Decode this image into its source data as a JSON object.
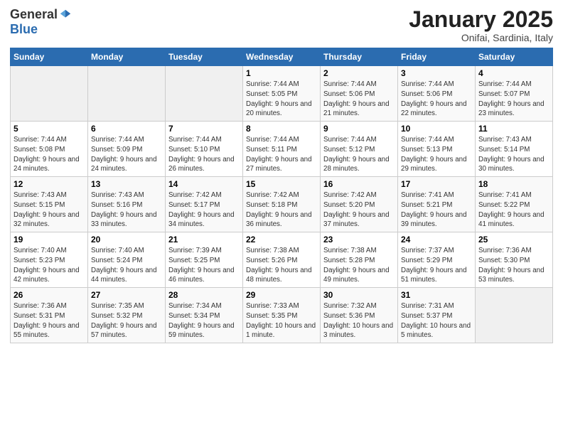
{
  "logo": {
    "general": "General",
    "blue": "Blue"
  },
  "header": {
    "month": "January 2025",
    "location": "Onifai, Sardinia, Italy"
  },
  "weekdays": [
    "Sunday",
    "Monday",
    "Tuesday",
    "Wednesday",
    "Thursday",
    "Friday",
    "Saturday"
  ],
  "weeks": [
    [
      {
        "day": "",
        "sunrise": "",
        "sunset": "",
        "daylight": ""
      },
      {
        "day": "",
        "sunrise": "",
        "sunset": "",
        "daylight": ""
      },
      {
        "day": "",
        "sunrise": "",
        "sunset": "",
        "daylight": ""
      },
      {
        "day": "1",
        "sunrise": "Sunrise: 7:44 AM",
        "sunset": "Sunset: 5:05 PM",
        "daylight": "Daylight: 9 hours and 20 minutes."
      },
      {
        "day": "2",
        "sunrise": "Sunrise: 7:44 AM",
        "sunset": "Sunset: 5:06 PM",
        "daylight": "Daylight: 9 hours and 21 minutes."
      },
      {
        "day": "3",
        "sunrise": "Sunrise: 7:44 AM",
        "sunset": "Sunset: 5:06 PM",
        "daylight": "Daylight: 9 hours and 22 minutes."
      },
      {
        "day": "4",
        "sunrise": "Sunrise: 7:44 AM",
        "sunset": "Sunset: 5:07 PM",
        "daylight": "Daylight: 9 hours and 23 minutes."
      }
    ],
    [
      {
        "day": "5",
        "sunrise": "Sunrise: 7:44 AM",
        "sunset": "Sunset: 5:08 PM",
        "daylight": "Daylight: 9 hours and 24 minutes."
      },
      {
        "day": "6",
        "sunrise": "Sunrise: 7:44 AM",
        "sunset": "Sunset: 5:09 PM",
        "daylight": "Daylight: 9 hours and 24 minutes."
      },
      {
        "day": "7",
        "sunrise": "Sunrise: 7:44 AM",
        "sunset": "Sunset: 5:10 PM",
        "daylight": "Daylight: 9 hours and 26 minutes."
      },
      {
        "day": "8",
        "sunrise": "Sunrise: 7:44 AM",
        "sunset": "Sunset: 5:11 PM",
        "daylight": "Daylight: 9 hours and 27 minutes."
      },
      {
        "day": "9",
        "sunrise": "Sunrise: 7:44 AM",
        "sunset": "Sunset: 5:12 PM",
        "daylight": "Daylight: 9 hours and 28 minutes."
      },
      {
        "day": "10",
        "sunrise": "Sunrise: 7:44 AM",
        "sunset": "Sunset: 5:13 PM",
        "daylight": "Daylight: 9 hours and 29 minutes."
      },
      {
        "day": "11",
        "sunrise": "Sunrise: 7:43 AM",
        "sunset": "Sunset: 5:14 PM",
        "daylight": "Daylight: 9 hours and 30 minutes."
      }
    ],
    [
      {
        "day": "12",
        "sunrise": "Sunrise: 7:43 AM",
        "sunset": "Sunset: 5:15 PM",
        "daylight": "Daylight: 9 hours and 32 minutes."
      },
      {
        "day": "13",
        "sunrise": "Sunrise: 7:43 AM",
        "sunset": "Sunset: 5:16 PM",
        "daylight": "Daylight: 9 hours and 33 minutes."
      },
      {
        "day": "14",
        "sunrise": "Sunrise: 7:42 AM",
        "sunset": "Sunset: 5:17 PM",
        "daylight": "Daylight: 9 hours and 34 minutes."
      },
      {
        "day": "15",
        "sunrise": "Sunrise: 7:42 AM",
        "sunset": "Sunset: 5:18 PM",
        "daylight": "Daylight: 9 hours and 36 minutes."
      },
      {
        "day": "16",
        "sunrise": "Sunrise: 7:42 AM",
        "sunset": "Sunset: 5:20 PM",
        "daylight": "Daylight: 9 hours and 37 minutes."
      },
      {
        "day": "17",
        "sunrise": "Sunrise: 7:41 AM",
        "sunset": "Sunset: 5:21 PM",
        "daylight": "Daylight: 9 hours and 39 minutes."
      },
      {
        "day": "18",
        "sunrise": "Sunrise: 7:41 AM",
        "sunset": "Sunset: 5:22 PM",
        "daylight": "Daylight: 9 hours and 41 minutes."
      }
    ],
    [
      {
        "day": "19",
        "sunrise": "Sunrise: 7:40 AM",
        "sunset": "Sunset: 5:23 PM",
        "daylight": "Daylight: 9 hours and 42 minutes."
      },
      {
        "day": "20",
        "sunrise": "Sunrise: 7:40 AM",
        "sunset": "Sunset: 5:24 PM",
        "daylight": "Daylight: 9 hours and 44 minutes."
      },
      {
        "day": "21",
        "sunrise": "Sunrise: 7:39 AM",
        "sunset": "Sunset: 5:25 PM",
        "daylight": "Daylight: 9 hours and 46 minutes."
      },
      {
        "day": "22",
        "sunrise": "Sunrise: 7:38 AM",
        "sunset": "Sunset: 5:26 PM",
        "daylight": "Daylight: 9 hours and 48 minutes."
      },
      {
        "day": "23",
        "sunrise": "Sunrise: 7:38 AM",
        "sunset": "Sunset: 5:28 PM",
        "daylight": "Daylight: 9 hours and 49 minutes."
      },
      {
        "day": "24",
        "sunrise": "Sunrise: 7:37 AM",
        "sunset": "Sunset: 5:29 PM",
        "daylight": "Daylight: 9 hours and 51 minutes."
      },
      {
        "day": "25",
        "sunrise": "Sunrise: 7:36 AM",
        "sunset": "Sunset: 5:30 PM",
        "daylight": "Daylight: 9 hours and 53 minutes."
      }
    ],
    [
      {
        "day": "26",
        "sunrise": "Sunrise: 7:36 AM",
        "sunset": "Sunset: 5:31 PM",
        "daylight": "Daylight: 9 hours and 55 minutes."
      },
      {
        "day": "27",
        "sunrise": "Sunrise: 7:35 AM",
        "sunset": "Sunset: 5:32 PM",
        "daylight": "Daylight: 9 hours and 57 minutes."
      },
      {
        "day": "28",
        "sunrise": "Sunrise: 7:34 AM",
        "sunset": "Sunset: 5:34 PM",
        "daylight": "Daylight: 9 hours and 59 minutes."
      },
      {
        "day": "29",
        "sunrise": "Sunrise: 7:33 AM",
        "sunset": "Sunset: 5:35 PM",
        "daylight": "Daylight: 10 hours and 1 minute."
      },
      {
        "day": "30",
        "sunrise": "Sunrise: 7:32 AM",
        "sunset": "Sunset: 5:36 PM",
        "daylight": "Daylight: 10 hours and 3 minutes."
      },
      {
        "day": "31",
        "sunrise": "Sunrise: 7:31 AM",
        "sunset": "Sunset: 5:37 PM",
        "daylight": "Daylight: 10 hours and 5 minutes."
      },
      {
        "day": "",
        "sunrise": "",
        "sunset": "",
        "daylight": ""
      }
    ]
  ]
}
